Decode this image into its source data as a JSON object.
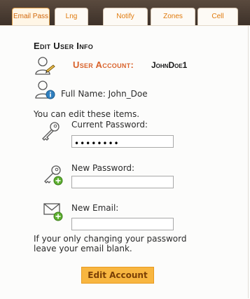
{
  "tabs": [
    {
      "label": "Email Pass",
      "active": true
    },
    {
      "label": "Lng",
      "active": false
    },
    {
      "label": "Notify",
      "active": false
    },
    {
      "label": "Zones",
      "active": false
    },
    {
      "label": "Cell",
      "active": false
    }
  ],
  "heading": "Edit User Info",
  "account": {
    "label": "User Account:",
    "value": "JohnDoe1"
  },
  "full_name": "Full Name: John_Doe",
  "edit_note": "You can edit these items.",
  "current_password": {
    "label": "Current Password:",
    "value": "••••••••"
  },
  "new_password": {
    "label": "New Password:",
    "value": ""
  },
  "new_email": {
    "label": "New Email:",
    "value": ""
  },
  "footer_note_line1": "If your only changing your password",
  "footer_note_line2": "leave your email blank.",
  "submit_label": "Edit Account",
  "colors": {
    "accent": "#e07a0c",
    "button": "#f8b640",
    "header_bg": "#4a3b31",
    "account_label": "#d9622b"
  }
}
